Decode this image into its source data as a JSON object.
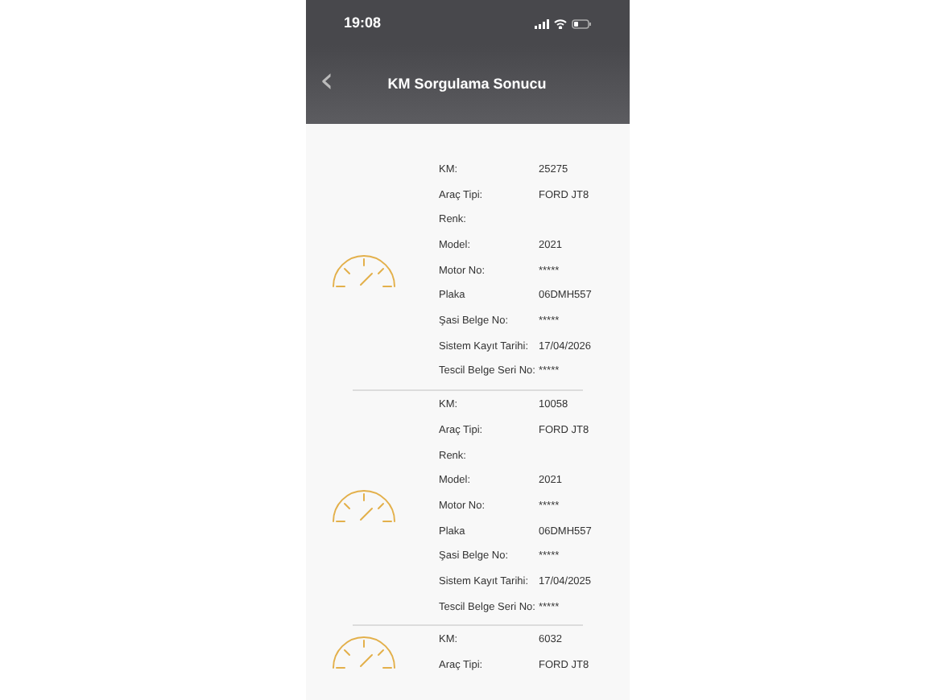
{
  "status_bar": {
    "time": "19:08"
  },
  "nav": {
    "back_icon": "‹",
    "title": "KM Sorgulama Sonucu"
  },
  "records": [
    {
      "fields": [
        {
          "label": "KM:",
          "value": "25275"
        },
        {
          "label": "Araç Tipi:",
          "value": "FORD JT8"
        },
        {
          "label": "Renk:"
        },
        {
          "label": "Model:",
          "value": "2021"
        },
        {
          "label": "Motor No:",
          "value": "*****"
        },
        {
          "label": "Plaka",
          "value": "06DMH557"
        },
        {
          "label": "Şasi Belge No:",
          "value": "*****"
        },
        {
          "label": "Sistem Kayıt Tarihi:",
          "value": "17/04/2026"
        },
        {
          "label": "Tescil Belge Seri No:",
          "value": "*****"
        }
      ]
    },
    {
      "fields": [
        {
          "label": "KM:",
          "value": "10058"
        },
        {
          "label": "Araç Tipi:",
          "value": "FORD JT8"
        },
        {
          "label": "Renk:"
        },
        {
          "label": "Model:",
          "value": "2021"
        },
        {
          "label": "Motor No:",
          "value": "*****"
        },
        {
          "label": "Plaka",
          "value": "06DMH557"
        },
        {
          "label": "Şasi Belge No:",
          "value": "*****"
        },
        {
          "label": "Sistem Kayıt Tarihi:",
          "value": "17/04/2025"
        },
        {
          "label": "Tescil Belge Seri No:",
          "value": "*****"
        }
      ]
    },
    {
      "fields": [
        {
          "label": "KM:",
          "value": "6032"
        },
        {
          "label": "Araç Tipi:",
          "value": "FORD JT8"
        }
      ]
    }
  ]
}
